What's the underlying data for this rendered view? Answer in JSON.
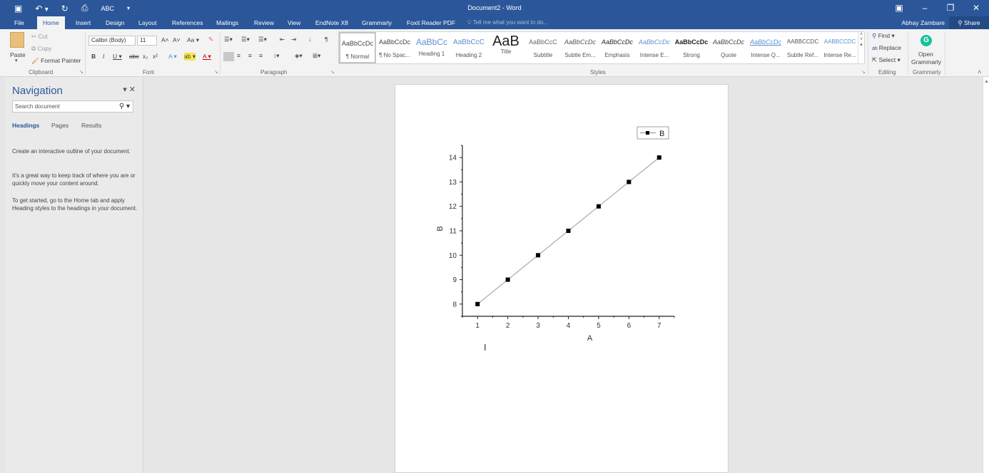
{
  "window": {
    "title": "Document2 - Word",
    "controls": [
      "ribbon-display-icon",
      "minimize-icon",
      "restore-icon",
      "close-icon"
    ]
  },
  "qat": {
    "save": "🖫",
    "undo": "↶ ▾",
    "redo": "↻",
    "print_preview": "⎙",
    "spelling": "ABC",
    "customize": "▾"
  },
  "tabs": [
    "File",
    "Home",
    "Insert",
    "Design",
    "Layout",
    "References",
    "Mailings",
    "Review",
    "View",
    "EndNote X8",
    "Grammarly",
    "Foxit Reader PDF"
  ],
  "active_tab": "Home",
  "tell_me": "Tell me what you want to do...",
  "user": "Abhay Zambare",
  "share": "Share",
  "clipboard": {
    "paste": "Paste",
    "cut": "Cut",
    "copy": "Copy",
    "format_painter": "Format Painter",
    "label": "Clipboard"
  },
  "font": {
    "name": "Calibri (Body)",
    "size": "11",
    "label": "Font",
    "row1": [
      "A˄",
      "A˅",
      "Aa ▾",
      "✎"
    ],
    "row2": [
      "B",
      "I",
      "U ▾",
      "abc",
      "x₂",
      "x²",
      "A ▾",
      "ab ▾",
      "A ▾"
    ]
  },
  "paragraph": {
    "label": "Paragraph"
  },
  "styles": {
    "label": "Styles",
    "items": [
      {
        "preview": "AaBbCcDc",
        "label": "¶ Normal"
      },
      {
        "preview": "AaBbCcDc",
        "label": "¶ No Spac..."
      },
      {
        "preview": "AaBbCc",
        "label": "Heading 1"
      },
      {
        "preview": "AaBbCcC",
        "label": "Heading 2"
      },
      {
        "preview": "AaB",
        "label": "Title"
      },
      {
        "preview": "AaBbCcC",
        "label": "Subtitle"
      },
      {
        "preview": "AaBbCcDc",
        "label": "Subtle Em..."
      },
      {
        "preview": "AaBbCcDc",
        "label": "Emphasis"
      },
      {
        "preview": "AaBbCcDc",
        "label": "Intense E..."
      },
      {
        "preview": "AaBbCcDc",
        "label": "Strong"
      },
      {
        "preview": "AaBbCcDc",
        "label": "Quote"
      },
      {
        "preview": "AaBbCcDc",
        "label": "Intense Q..."
      },
      {
        "preview": "AABBCCDC",
        "label": "Subtle Ref..."
      },
      {
        "preview": "AABBCCDC",
        "label": "Intense Re..."
      }
    ]
  },
  "editing": {
    "find": "Find ▾",
    "replace": "Replace",
    "select": "Select ▾",
    "label": "Editing"
  },
  "grammarly": {
    "open": "Open",
    "name": "Grammarly",
    "label": "Grammarly"
  },
  "navigation": {
    "title": "Navigation",
    "search_placeholder": "Search document",
    "tabs": [
      "Headings",
      "Pages",
      "Results"
    ],
    "active_tab": "Headings",
    "paragraphs": [
      "Create an interactive outline of your document.",
      "It's a great way to keep track of where you are or quickly move your content around.",
      "To get started, go to the Home tab and apply Heading styles to the headings in your document."
    ]
  },
  "chart_data": {
    "type": "line",
    "title": "",
    "xlabel": "A",
    "ylabel": "B",
    "x": [
      1,
      2,
      3,
      4,
      5,
      6,
      7
    ],
    "series": [
      {
        "name": "B",
        "values": [
          8,
          9,
          10,
          11,
          12,
          13,
          14
        ],
        "marker": "square",
        "color": "#000000",
        "line_color": "#aaaaaa"
      }
    ],
    "xlim": [
      0.5,
      7.5
    ],
    "ylim": [
      7.5,
      14.5
    ],
    "xticks": [
      1,
      2,
      3,
      4,
      5,
      6,
      7
    ],
    "yticks": [
      8,
      9,
      10,
      11,
      12,
      13,
      14
    ],
    "grid": false,
    "legend": "top-right"
  },
  "colors": {
    "brand": "#2b579a",
    "grammarly": "#15c39a"
  }
}
